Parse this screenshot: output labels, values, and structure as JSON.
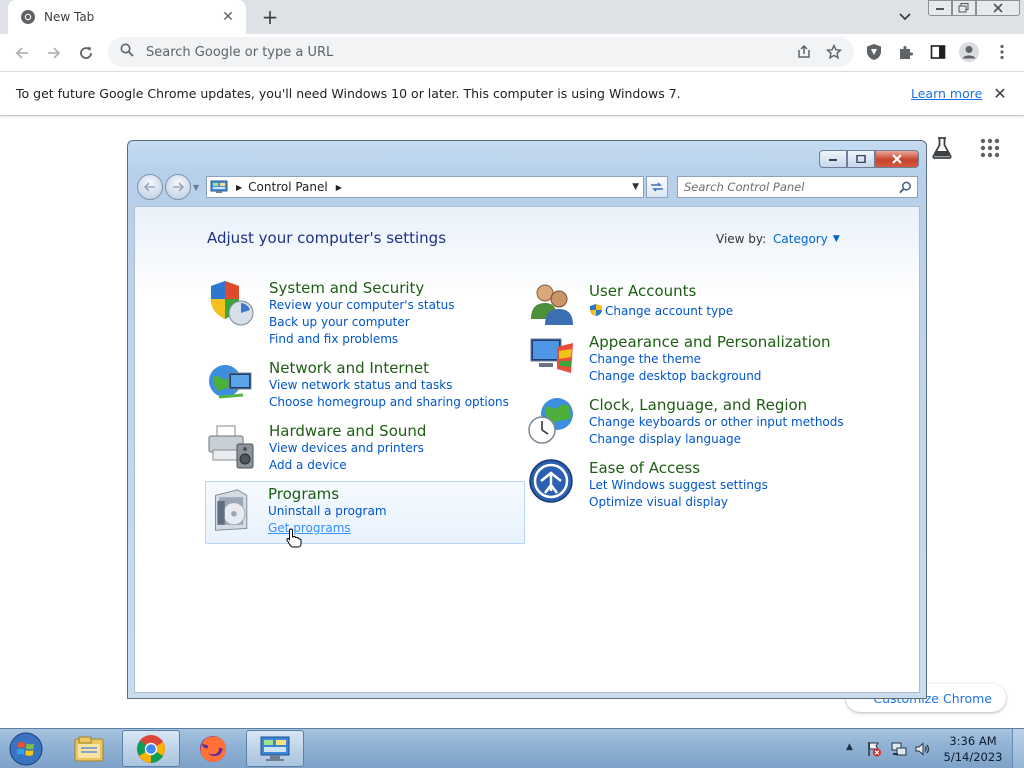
{
  "browser": {
    "tab": {
      "title": "New Tab"
    },
    "omnibox": {
      "placeholder": "Search Google or type a URL"
    },
    "infobar": {
      "message": "To get future Google Chrome updates, you'll need Windows 10 or later. This computer is using Windows 7.",
      "link": "Learn more"
    },
    "customize_label": "Customize Chrome",
    "icons": [
      "chrome-favicon-icon",
      "close-icon",
      "plus-icon",
      "chevron-down-icon",
      "back-icon",
      "forward-icon",
      "reload-icon",
      "search-icon",
      "share-icon",
      "star-icon",
      "shield-extension-icon",
      "puzzle-icon",
      "side-panel-icon",
      "profile-icon",
      "kebab-menu-icon",
      "labs-flask-icon",
      "apps-grid-icon"
    ]
  },
  "control_panel": {
    "breadcrumb": "Control Panel",
    "search_placeholder": "Search Control Panel",
    "heading": "Adjust your computer's settings",
    "view_by_label": "View by:",
    "view_by_value": "Category",
    "categories": [
      {
        "title": "System and Security",
        "links": [
          "Review your computer's status",
          "Back up your computer",
          "Find and fix problems"
        ]
      },
      {
        "title": "Network and Internet",
        "links": [
          "View network status and tasks",
          "Choose homegroup and sharing options"
        ]
      },
      {
        "title": "Hardware and Sound",
        "links": [
          "View devices and printers",
          "Add a device"
        ]
      },
      {
        "title": "Programs",
        "links": [
          "Uninstall a program",
          "Get programs"
        ]
      },
      {
        "title": "User Accounts",
        "links": [
          "Change account type"
        ]
      },
      {
        "title": "Appearance and Personalization",
        "links": [
          "Change the theme",
          "Change desktop background"
        ]
      },
      {
        "title": "Clock, Language, and Region",
        "links": [
          "Change keyboards or other input methods",
          "Change display language"
        ]
      },
      {
        "title": "Ease of Access",
        "links": [
          "Let Windows suggest settings",
          "Optimize visual display"
        ]
      }
    ]
  },
  "taskbar": {
    "clock_time": "3:36 AM",
    "clock_date": "5/14/2023",
    "apps": [
      "windows-explorer-icon",
      "chrome-icon",
      "firefox-icon",
      "control-panel-icon"
    ]
  },
  "colors": {
    "chrome_link": "#1a73e8",
    "cp_heading": "#1e3287",
    "cp_category_title": "#1e5d14",
    "cp_link": "#0055cc"
  }
}
